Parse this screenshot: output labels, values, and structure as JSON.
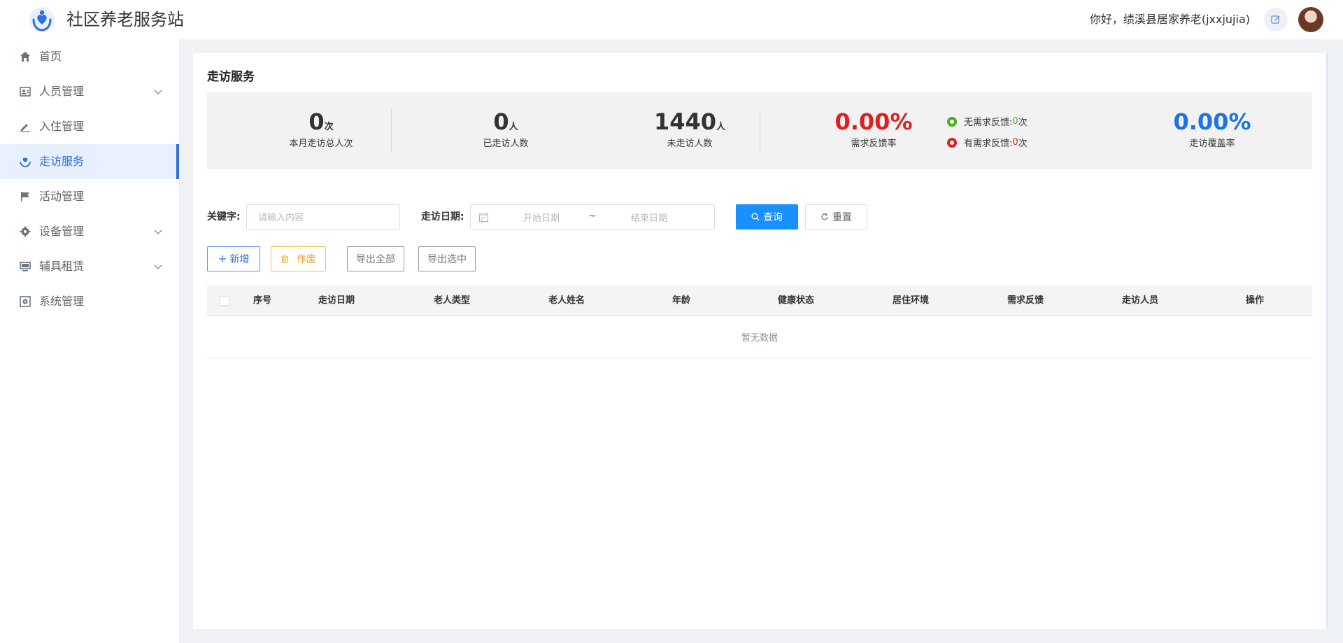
{
  "header": {
    "app_title": "社区养老服务站",
    "greeting": "你好，绩溪县居家养老(jxxjujia)",
    "logo_icon": "heart-hands-logo-icon",
    "edit_icon": "edit-icon"
  },
  "sidebar": {
    "items": [
      {
        "label": "首页",
        "icon": "home-icon",
        "has_children": false,
        "active": false
      },
      {
        "label": "人员管理",
        "icon": "person-card-icon",
        "has_children": true,
        "active": false
      },
      {
        "label": "入住管理",
        "icon": "pen-icon",
        "has_children": false,
        "active": false
      },
      {
        "label": "走访服务",
        "icon": "hand-heart-icon",
        "has_children": false,
        "active": true
      },
      {
        "label": "活动管理",
        "icon": "flag-icon",
        "has_children": false,
        "active": false
      },
      {
        "label": "设备管理",
        "icon": "gear-icon",
        "has_children": true,
        "active": false
      },
      {
        "label": "辅具租赁",
        "icon": "monitor-icon",
        "has_children": true,
        "active": false
      },
      {
        "label": "系统管理",
        "icon": "settings-box-icon",
        "has_children": false,
        "active": false
      }
    ]
  },
  "main": {
    "title": "走访服务",
    "stats": {
      "monthly_visits": {
        "value": "0",
        "unit": "次",
        "label": "本月走访总人次"
      },
      "visited": {
        "value": "0",
        "unit": "人",
        "label": "已走访人数"
      },
      "not_visited": {
        "value": "1440",
        "unit": "人",
        "label": "未走访人数"
      },
      "feedback_rate": {
        "value": "0.00%",
        "label": "需求反馈率"
      },
      "no_need_feedback": {
        "label": "无需求反馈:",
        "value": "0",
        "unit": "次"
      },
      "has_need_feedback": {
        "label": "有需求反馈:",
        "value": "0",
        "unit": "次"
      },
      "coverage_rate": {
        "value": "0.00%",
        "label": "走访覆盖率"
      }
    },
    "search": {
      "keyword_label": "关键字:",
      "keyword_placeholder": "请输入内容",
      "date_label": "走访日期:",
      "start_placeholder": "开始日期",
      "separator": "~",
      "end_placeholder": "结束日期",
      "query_label": "查询",
      "reset_label": "重置"
    },
    "toolbar": {
      "add_label": "新增",
      "void_label": "作废",
      "export_all_label": "导出全部",
      "export_selected_label": "导出选中"
    },
    "table": {
      "columns": [
        "序号",
        "走访日期",
        "老人类型",
        "老人姓名",
        "年龄",
        "健康状态",
        "居住环境",
        "需求反馈",
        "走访人员",
        "操作"
      ],
      "empty_text": "暂无数据"
    }
  },
  "colors": {
    "primary": "#1890ff",
    "active_nav": "#2f6fe0",
    "red": "#e02020",
    "green": "#4caf1a",
    "orange": "#f0a020"
  }
}
